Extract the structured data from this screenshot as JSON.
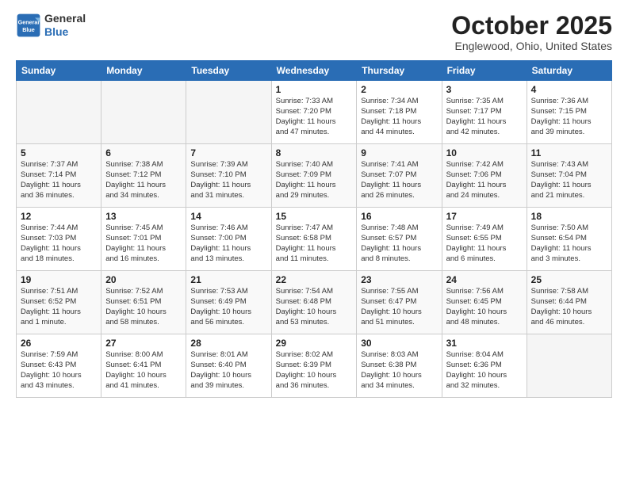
{
  "logo": {
    "text_general": "General",
    "text_blue": "Blue"
  },
  "title": "October 2025",
  "location": "Englewood, Ohio, United States",
  "days_of_week": [
    "Sunday",
    "Monday",
    "Tuesday",
    "Wednesday",
    "Thursday",
    "Friday",
    "Saturday"
  ],
  "weeks": [
    [
      {
        "day": "",
        "info": ""
      },
      {
        "day": "",
        "info": ""
      },
      {
        "day": "",
        "info": ""
      },
      {
        "day": "1",
        "info": "Sunrise: 7:33 AM\nSunset: 7:20 PM\nDaylight: 11 hours\nand 47 minutes."
      },
      {
        "day": "2",
        "info": "Sunrise: 7:34 AM\nSunset: 7:18 PM\nDaylight: 11 hours\nand 44 minutes."
      },
      {
        "day": "3",
        "info": "Sunrise: 7:35 AM\nSunset: 7:17 PM\nDaylight: 11 hours\nand 42 minutes."
      },
      {
        "day": "4",
        "info": "Sunrise: 7:36 AM\nSunset: 7:15 PM\nDaylight: 11 hours\nand 39 minutes."
      }
    ],
    [
      {
        "day": "5",
        "info": "Sunrise: 7:37 AM\nSunset: 7:14 PM\nDaylight: 11 hours\nand 36 minutes."
      },
      {
        "day": "6",
        "info": "Sunrise: 7:38 AM\nSunset: 7:12 PM\nDaylight: 11 hours\nand 34 minutes."
      },
      {
        "day": "7",
        "info": "Sunrise: 7:39 AM\nSunset: 7:10 PM\nDaylight: 11 hours\nand 31 minutes."
      },
      {
        "day": "8",
        "info": "Sunrise: 7:40 AM\nSunset: 7:09 PM\nDaylight: 11 hours\nand 29 minutes."
      },
      {
        "day": "9",
        "info": "Sunrise: 7:41 AM\nSunset: 7:07 PM\nDaylight: 11 hours\nand 26 minutes."
      },
      {
        "day": "10",
        "info": "Sunrise: 7:42 AM\nSunset: 7:06 PM\nDaylight: 11 hours\nand 24 minutes."
      },
      {
        "day": "11",
        "info": "Sunrise: 7:43 AM\nSunset: 7:04 PM\nDaylight: 11 hours\nand 21 minutes."
      }
    ],
    [
      {
        "day": "12",
        "info": "Sunrise: 7:44 AM\nSunset: 7:03 PM\nDaylight: 11 hours\nand 18 minutes."
      },
      {
        "day": "13",
        "info": "Sunrise: 7:45 AM\nSunset: 7:01 PM\nDaylight: 11 hours\nand 16 minutes."
      },
      {
        "day": "14",
        "info": "Sunrise: 7:46 AM\nSunset: 7:00 PM\nDaylight: 11 hours\nand 13 minutes."
      },
      {
        "day": "15",
        "info": "Sunrise: 7:47 AM\nSunset: 6:58 PM\nDaylight: 11 hours\nand 11 minutes."
      },
      {
        "day": "16",
        "info": "Sunrise: 7:48 AM\nSunset: 6:57 PM\nDaylight: 11 hours\nand 8 minutes."
      },
      {
        "day": "17",
        "info": "Sunrise: 7:49 AM\nSunset: 6:55 PM\nDaylight: 11 hours\nand 6 minutes."
      },
      {
        "day": "18",
        "info": "Sunrise: 7:50 AM\nSunset: 6:54 PM\nDaylight: 11 hours\nand 3 minutes."
      }
    ],
    [
      {
        "day": "19",
        "info": "Sunrise: 7:51 AM\nSunset: 6:52 PM\nDaylight: 11 hours\nand 1 minute."
      },
      {
        "day": "20",
        "info": "Sunrise: 7:52 AM\nSunset: 6:51 PM\nDaylight: 10 hours\nand 58 minutes."
      },
      {
        "day": "21",
        "info": "Sunrise: 7:53 AM\nSunset: 6:49 PM\nDaylight: 10 hours\nand 56 minutes."
      },
      {
        "day": "22",
        "info": "Sunrise: 7:54 AM\nSunset: 6:48 PM\nDaylight: 10 hours\nand 53 minutes."
      },
      {
        "day": "23",
        "info": "Sunrise: 7:55 AM\nSunset: 6:47 PM\nDaylight: 10 hours\nand 51 minutes."
      },
      {
        "day": "24",
        "info": "Sunrise: 7:56 AM\nSunset: 6:45 PM\nDaylight: 10 hours\nand 48 minutes."
      },
      {
        "day": "25",
        "info": "Sunrise: 7:58 AM\nSunset: 6:44 PM\nDaylight: 10 hours\nand 46 minutes."
      }
    ],
    [
      {
        "day": "26",
        "info": "Sunrise: 7:59 AM\nSunset: 6:43 PM\nDaylight: 10 hours\nand 43 minutes."
      },
      {
        "day": "27",
        "info": "Sunrise: 8:00 AM\nSunset: 6:41 PM\nDaylight: 10 hours\nand 41 minutes."
      },
      {
        "day": "28",
        "info": "Sunrise: 8:01 AM\nSunset: 6:40 PM\nDaylight: 10 hours\nand 39 minutes."
      },
      {
        "day": "29",
        "info": "Sunrise: 8:02 AM\nSunset: 6:39 PM\nDaylight: 10 hours\nand 36 minutes."
      },
      {
        "day": "30",
        "info": "Sunrise: 8:03 AM\nSunset: 6:38 PM\nDaylight: 10 hours\nand 34 minutes."
      },
      {
        "day": "31",
        "info": "Sunrise: 8:04 AM\nSunset: 6:36 PM\nDaylight: 10 hours\nand 32 minutes."
      },
      {
        "day": "",
        "info": ""
      }
    ]
  ]
}
